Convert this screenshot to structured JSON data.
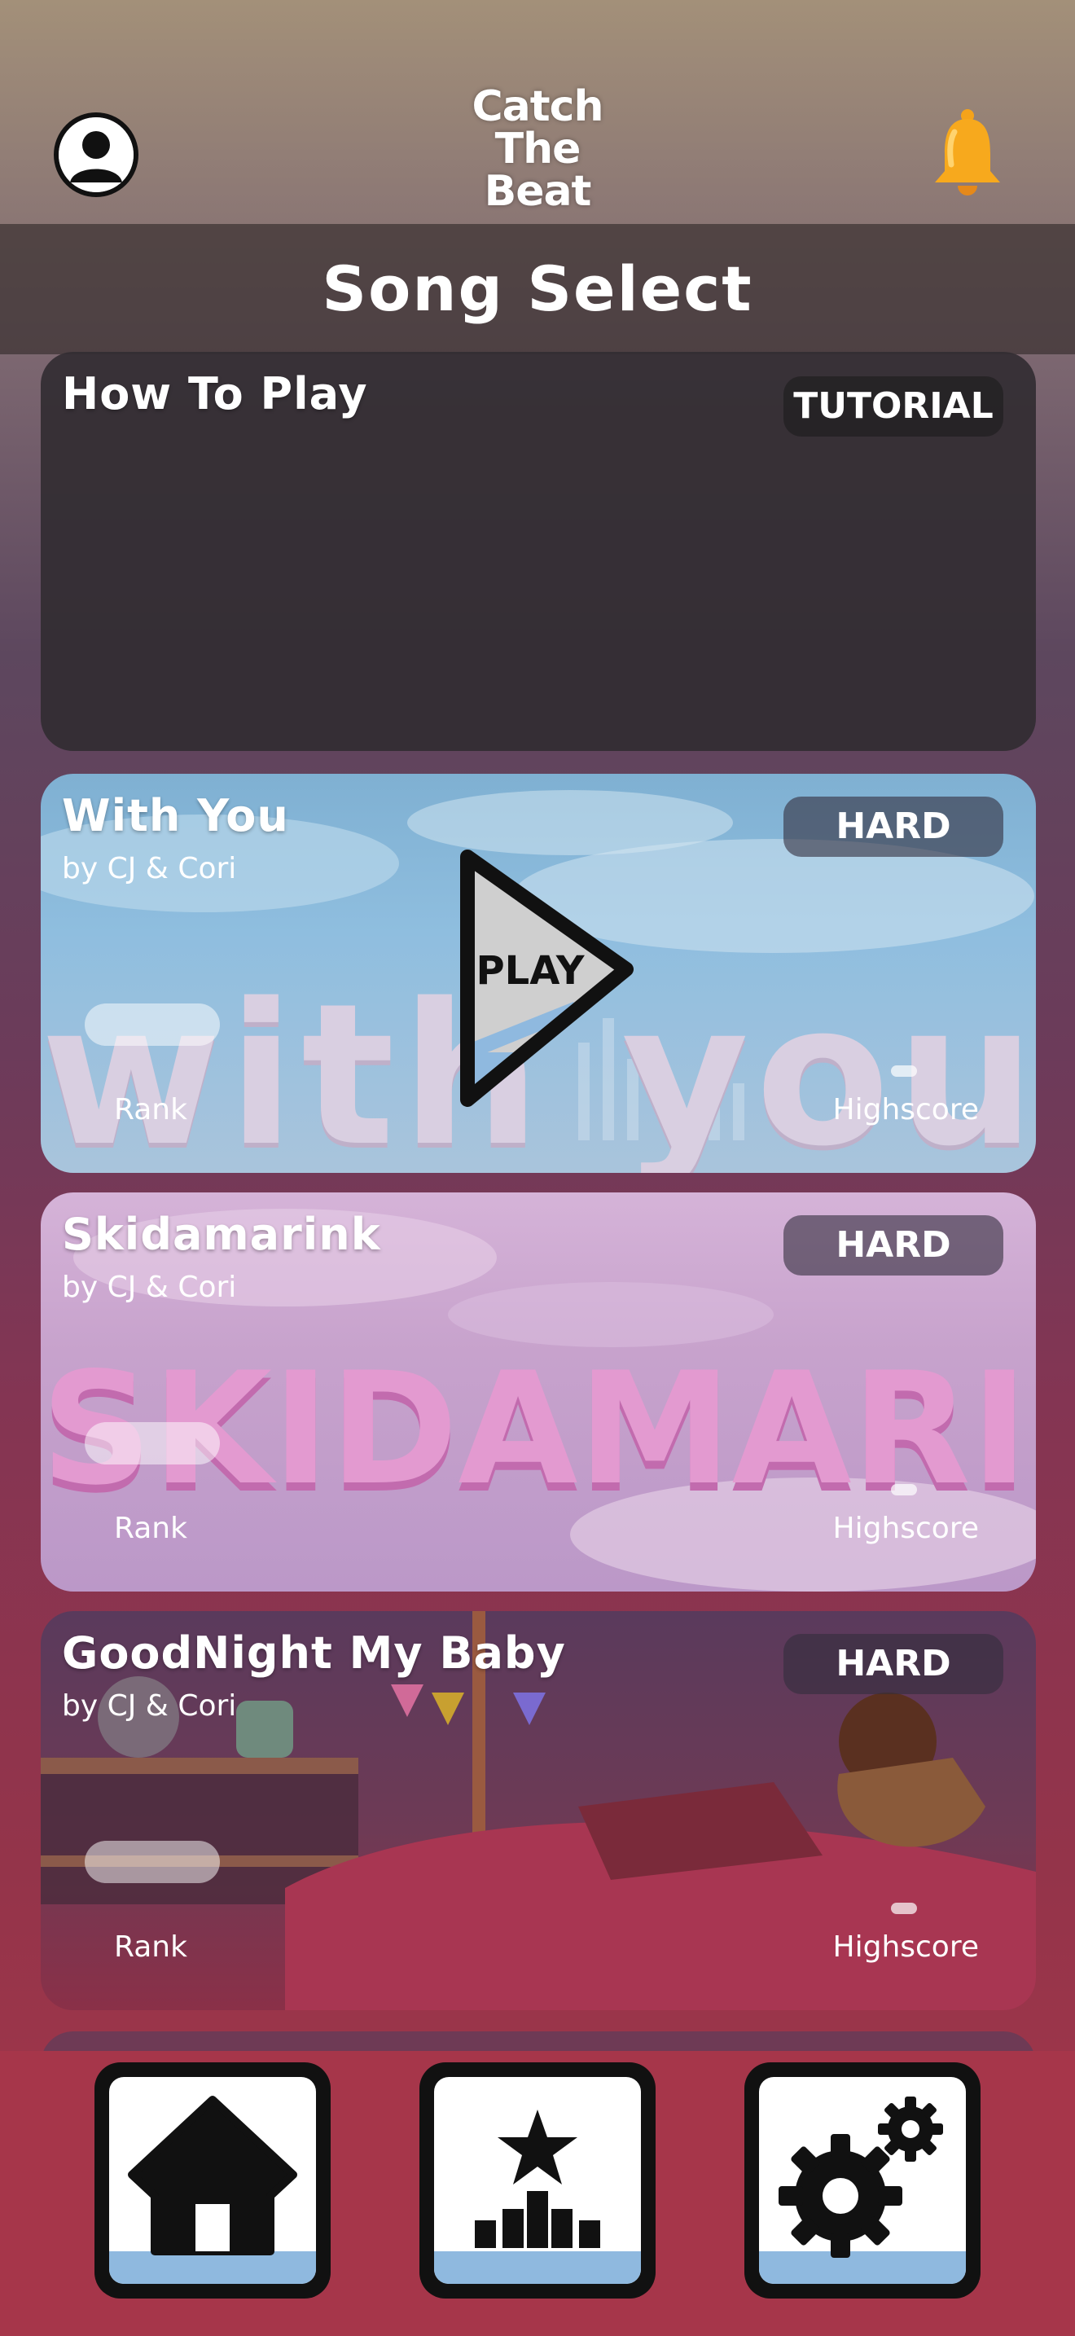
{
  "header": {
    "logo_lines": [
      "Catch",
      "The",
      "Beat"
    ],
    "profile_icon": "user-avatar-icon",
    "notification_icon": "bell-icon"
  },
  "section": {
    "title": "Song Select"
  },
  "tutorial_card": {
    "title": "How To Play",
    "badge": "TUTORIAL"
  },
  "songs": [
    {
      "title": "With You",
      "artist": "by CJ & Cori",
      "difficulty": "HARD",
      "rank_label": "Rank",
      "highscore_label": "Highscore",
      "background_word": "with you"
    },
    {
      "title": "Skidamarink",
      "artist": "by CJ & Cori",
      "difficulty": "HARD",
      "rank_label": "Rank",
      "highscore_label": "Highscore",
      "background_word": "SKIDAMARINK"
    },
    {
      "title": "GoodNight My Baby",
      "artist": "by CJ & Cori",
      "difficulty": "HARD",
      "rank_label": "Rank",
      "highscore_label": "Highscore"
    }
  ],
  "play_button": {
    "label": "PLAY"
  },
  "bottom_nav": [
    {
      "icon": "home-icon"
    },
    {
      "icon": "leaderboard-icon"
    },
    {
      "icon": "settings-gears-icon"
    }
  ],
  "colors": {
    "bottom_bar": "#a6364a",
    "badge_bg": "#3c3648",
    "play_fill": "#cfcfcf",
    "play_shade": "#8fb9df",
    "nav_shade": "#8fb9df"
  }
}
